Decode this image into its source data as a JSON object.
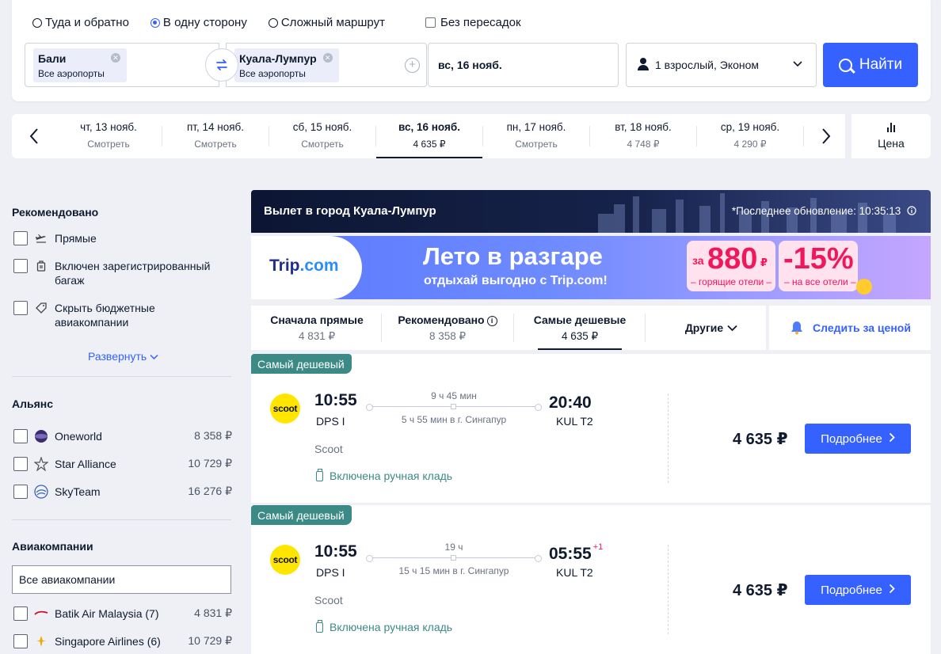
{
  "search": {
    "trip_types": [
      "Туда и обратно",
      "В одну сторону",
      "Сложный маршрут"
    ],
    "selected_trip_type": "В одну сторону",
    "nonstop_label": "Без пересадок",
    "from": {
      "city": "Бали",
      "airports": "Все аэропорты"
    },
    "to": {
      "city": "Куала-Лумпур",
      "airports": "Все аэропорты"
    },
    "date": "вс, 16 нояб.",
    "passengers": "1 взрослый, Эконом",
    "search_button": "Найти"
  },
  "date_strip": {
    "days": [
      {
        "date": "чт, 13 нояб.",
        "price": "Смотреть",
        "active": false
      },
      {
        "date": "пт, 14 нояб.",
        "price": "Смотреть",
        "active": false
      },
      {
        "date": "сб, 15 нояб.",
        "price": "Смотреть",
        "active": false
      },
      {
        "date": "вс, 16 нояб.",
        "price": "4 635 ₽",
        "active": true
      },
      {
        "date": "пн, 17 нояб.",
        "price": "Смотреть",
        "active": false
      },
      {
        "date": "вт, 18 нояб.",
        "price": "4 748 ₽",
        "active": false
      },
      {
        "date": "ср, 19 нояб.",
        "price": "4 290 ₽",
        "active": false
      }
    ],
    "price_tab_label": "Цена"
  },
  "sidebar": {
    "recommended_title": "Рекомендовано",
    "recommended": [
      {
        "label": "Прямые",
        "icon": "plane-icon"
      },
      {
        "label": "Включен зарегистрированный багаж",
        "icon": "baggage-icon"
      },
      {
        "label": "Скрыть бюджетные авиакомпании",
        "icon": "tag-icon"
      }
    ],
    "expand_label": "Развернуть",
    "alliance_title": "Альянс",
    "alliances": [
      {
        "label": "Oneworld",
        "price": "8 358 ₽"
      },
      {
        "label": "Star Alliance",
        "price": "10 729 ₽"
      },
      {
        "label": "SkyTeam",
        "price": "16 276 ₽"
      }
    ],
    "airlines_title": "Авиакомпании",
    "airlines_select": "Все авиакомпании",
    "airlines": [
      {
        "label": "Batik Air Malaysia (7)",
        "price": "4 831 ₽"
      },
      {
        "label": "Singapore Airlines (6)",
        "price": "10 729 ₽"
      }
    ]
  },
  "results": {
    "header_title": "Вылет в город Куала-Лумпур",
    "last_update": "*Последнее обновление: 10:35:13",
    "banner": {
      "logo_trip": "Trip",
      "logo_com": ".com",
      "headline": "Лето в разгаре",
      "subline": "отдыхай выгодно с Trip.com!",
      "promo1_prefix": "за",
      "promo1_value": "880",
      "promo1_currency": "₽",
      "promo1_caption": "– горящие отели –",
      "promo2_value": "-15%",
      "promo2_caption": "– на все отели –"
    },
    "sort_tabs": [
      {
        "name": "Сначала прямые",
        "price": "4 831 ₽",
        "active": false
      },
      {
        "name": "Рекомендовано",
        "price": "8 358 ₽",
        "active": false
      },
      {
        "name": "Самые дешевые",
        "price": "4 635 ₽",
        "active": true
      }
    ],
    "other_label": "Другие",
    "watch_price_label": "Следить за ценой",
    "flights": [
      {
        "badge": "Самый дешевый",
        "airline_logo": "scoot",
        "dep_time": "10:55",
        "dep_airport": "DPS I",
        "arr_time": "20:40",
        "arr_day_offset": "",
        "arr_airport": "KUL T2",
        "duration": "9 ч 45 мин",
        "transfer": "5 ч 55 мин в г. Сингапур",
        "airline": "Scoot",
        "baggage": "Включена ручная кладь",
        "price": "4 635 ₽",
        "button": "Подробнее"
      },
      {
        "badge": "Самый дешевый",
        "airline_logo": "scoot",
        "dep_time": "10:55",
        "dep_airport": "DPS I",
        "arr_time": "05:55",
        "arr_day_offset": "+1",
        "arr_airport": "KUL T2",
        "duration": "19 ч",
        "transfer": "15 ч 15 мин в г. Сингапур",
        "airline": "Scoot",
        "baggage": "Включена ручная кладь",
        "price": "4 635 ₽",
        "button": "Подробнее"
      }
    ]
  },
  "colors": {
    "accent": "#3461ff",
    "badge": "#3b8a86",
    "promo": "#f0185b"
  }
}
